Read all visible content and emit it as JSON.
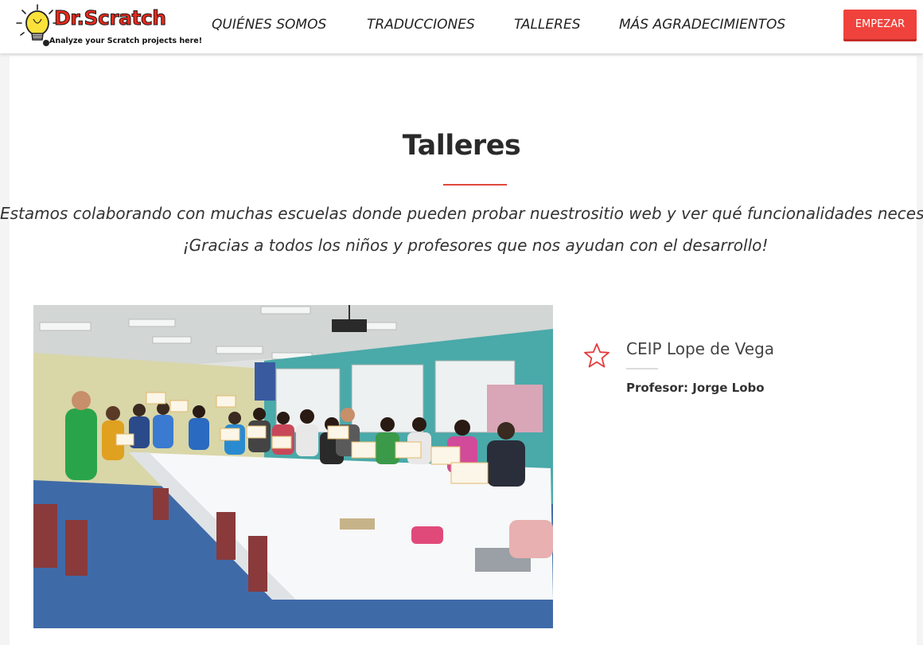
{
  "brand": {
    "name": "Dr.Scratch",
    "tagline": "Analyze your Scratch projects here!",
    "colors": {
      "accent": "#f0423c",
      "logo_red": "#e8291c",
      "rule": "#e0483c"
    }
  },
  "nav": {
    "items": [
      {
        "label": "QUIÉNES SOMOS"
      },
      {
        "label": "TRADUCCIONES"
      },
      {
        "label": "TALLERES"
      },
      {
        "label": "MÁS AGRADECIMIENTOS"
      }
    ],
    "cta_label": "EMPEZAR"
  },
  "section": {
    "title": "Talleres",
    "intro_line1": "Estamos colaborando con muchas escuelas donde pueden probar nuestrositio web y ver qué funcionalidades necesitan.",
    "intro_line2": "¡Gracias a todos los niños y profesores que nos ayudan con el desarrollo!"
  },
  "workshops": [
    {
      "school": "CEIP Lope de Vega",
      "teacher": "Profesor: Jorge Lobo",
      "icon": "star-outline-icon",
      "photo_icon": "classroom-photo"
    }
  ]
}
